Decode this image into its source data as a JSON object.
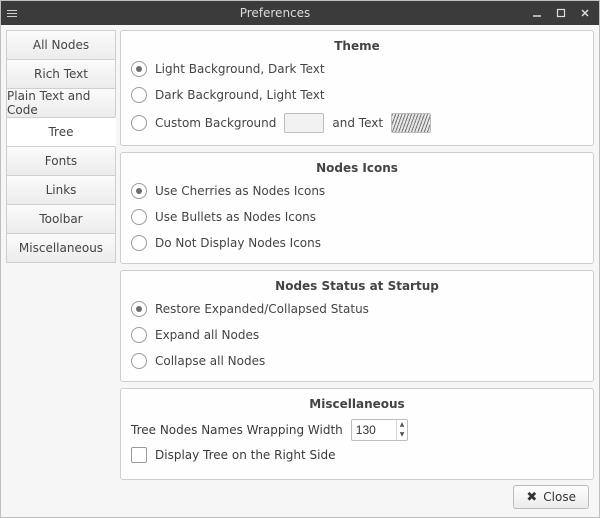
{
  "window": {
    "title": "Preferences"
  },
  "tabs": {
    "items": [
      "All Nodes",
      "Rich Text",
      "Plain Text and Code",
      "Tree",
      "Fonts",
      "Links",
      "Toolbar",
      "Miscellaneous"
    ],
    "active_index": 3
  },
  "theme": {
    "title": "Theme",
    "light": "Light Background, Dark Text",
    "dark": "Dark Background, Light Text",
    "custom_bg": "Custom Background",
    "custom_and_text": "and Text"
  },
  "nodes_icons": {
    "title": "Nodes Icons",
    "cherries": "Use Cherries as Nodes Icons",
    "bullets": "Use Bullets as Nodes Icons",
    "none": "Do Not Display Nodes Icons"
  },
  "startup": {
    "title": "Nodes Status at Startup",
    "restore": "Restore Expanded/Collapsed Status",
    "expand": "Expand all Nodes",
    "collapse": "Collapse all Nodes"
  },
  "misc": {
    "title": "Miscellaneous",
    "wrap_label": "Tree Nodes Names Wrapping Width",
    "wrap_value": "130",
    "right_side": "Display Tree on the Right Side"
  },
  "footer": {
    "close": "Close"
  }
}
